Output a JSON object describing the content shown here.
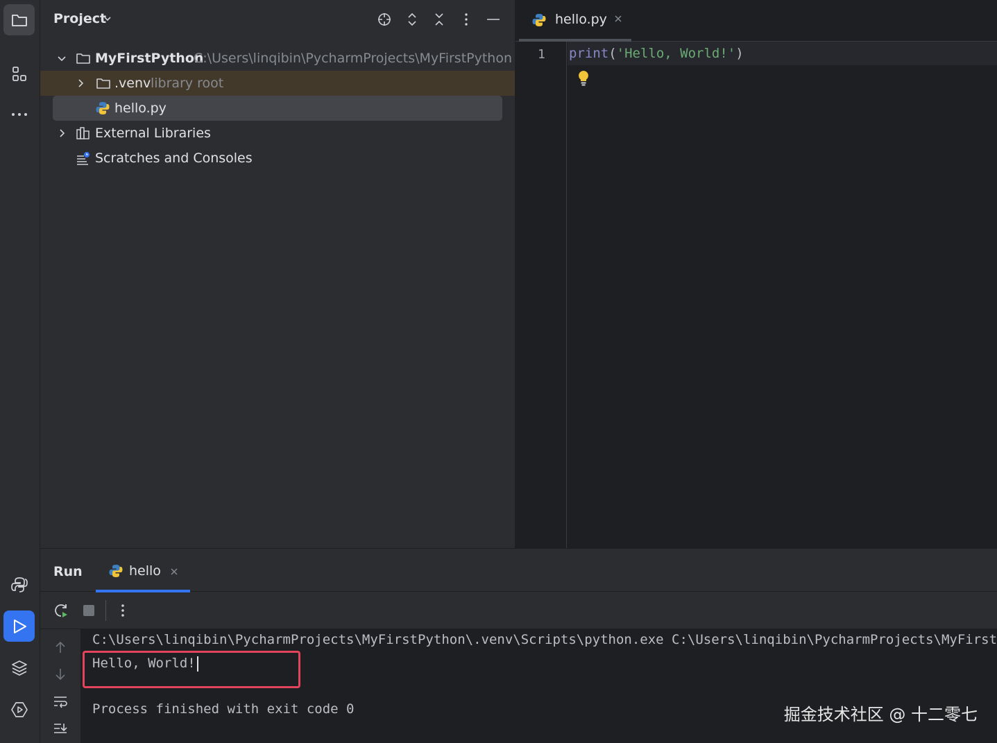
{
  "project_panel": {
    "title": "Project",
    "tree": {
      "root_name": "MyFirstPython",
      "root_path": "C:\\Users\\linqibin\\PycharmProjects\\MyFirstPython",
      "venv_name": ".venv",
      "venv_hint": "library root",
      "file_name": "hello.py",
      "external_libraries": "External Libraries",
      "scratches": "Scratches and Consoles"
    }
  },
  "editor": {
    "tab_label": "hello.py",
    "line_number": "1",
    "code": {
      "fn": "print",
      "open": "(",
      "str": "'Hello, World!'",
      "close": ")"
    }
  },
  "run_panel": {
    "title": "Run",
    "tab_label": "hello",
    "console": {
      "command": "C:\\Users\\linqibin\\PycharmProjects\\MyFirstPython\\.venv\\Scripts\\python.exe C:\\Users\\linqibin\\PycharmProjects\\MyFirstPython\\hello.py",
      "output": "Hello, World!",
      "exit": "Process finished with exit code 0"
    }
  },
  "watermark": "掘金技术社区 @ 十二零七",
  "colors": {
    "accent": "#3574f0",
    "highlight_box": "#e2445c",
    "string": "#6aab73",
    "builtin": "#8888c6"
  }
}
